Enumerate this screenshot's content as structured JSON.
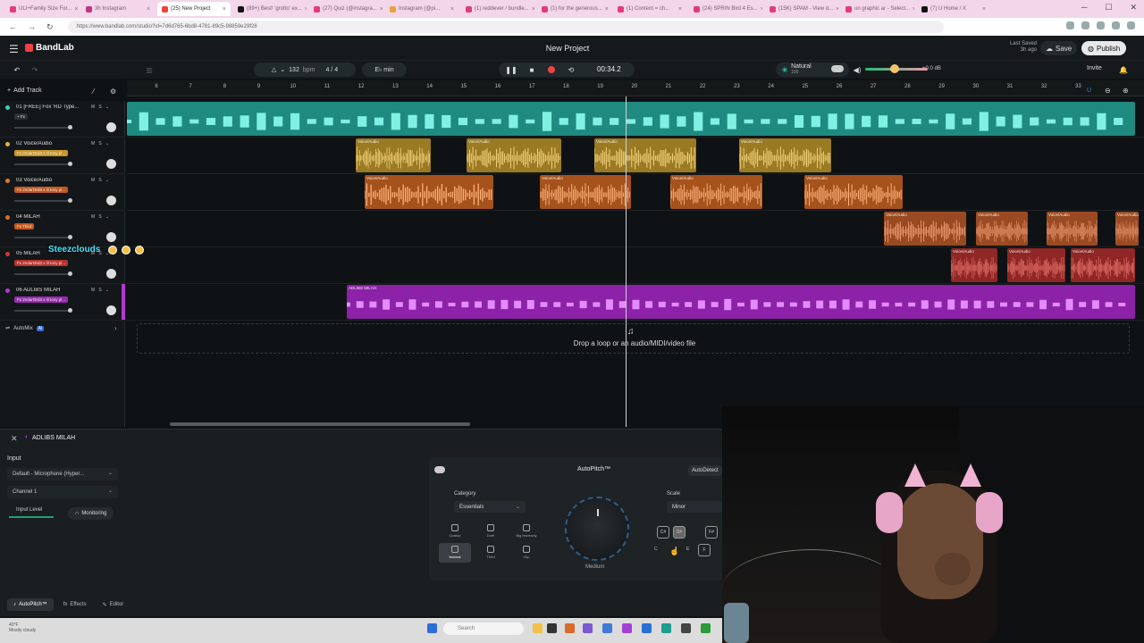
{
  "browser": {
    "tabs": [
      {
        "label": "ULI+Family Size For...",
        "color": "#e23b7b",
        "active": false
      },
      {
        "label": "3h Instagram",
        "color": "#c13584",
        "active": false
      },
      {
        "label": "(25) New Project",
        "color": "#f04040",
        "active": true
      },
      {
        "label": "(89+) Best! 'grotto' ex...",
        "color": "#111111",
        "active": false
      },
      {
        "label": "(27) Quiz (@instagra...",
        "color": "#e23b7b",
        "active": false
      },
      {
        "label": "Instagram (@pi...",
        "color": "#e8a13a",
        "active": false
      },
      {
        "label": "(1) reddever / bundle...",
        "color": "#e23b7b",
        "active": false
      },
      {
        "label": "(1) for the generous...",
        "color": "#e23b7b",
        "active": false
      },
      {
        "label": "(1) Content = ch...",
        "color": "#e23b7b",
        "active": false
      },
      {
        "label": "(24) SPRIN Bird 4 Es...",
        "color": "#e23b7b",
        "active": false
      },
      {
        "label": "(15K) SPAM - View d...",
        "color": "#e23b7b",
        "active": false
      },
      {
        "label": "un graphic ar - Select...",
        "color": "#e23b7b",
        "active": false
      },
      {
        "label": "(7) U Home / X",
        "color": "#111111",
        "active": false
      }
    ],
    "url": "https://www.bandlab.com/studio?id=7d6d765-6bd8-4781-89c5-98859e29f28"
  },
  "header": {
    "app_name": "BandLab",
    "project_title": "New Project",
    "last_saved_label": "Last Saved",
    "last_saved_time": "3h ago",
    "save_label": "Save",
    "publish_label": "Publish"
  },
  "transport": {
    "bpm_value": "132",
    "bpm_unit": "bpm",
    "time_signature": "4 / 4",
    "key": "E♭ min",
    "time": "00:34.2",
    "preset_label": "Natural",
    "preset_sub": "100",
    "db": "+0.0 dB",
    "invite_label": "Invite",
    "add_track_label": "Add Track"
  },
  "ruler": {
    "marks": [
      "6",
      "7",
      "8",
      "9",
      "10",
      "11",
      "12",
      "13",
      "14",
      "15",
      "16",
      "17",
      "18",
      "19",
      "20",
      "21",
      "22",
      "23",
      "24",
      "25",
      "26",
      "27",
      "28",
      "29",
      "30",
      "31",
      "32",
      "33"
    ]
  },
  "tracks": [
    {
      "name": "01 [FREE] Fox 'RD Type...",
      "fx": "+ Fx",
      "fx_color": "#2b3034",
      "color": "#3ad0c0"
    },
    {
      "name": "02 Voice/Audio",
      "fx": "Fx 2ndart3rd3 x lil tony pl...",
      "fx_color": "#c9962a",
      "color": "#e3b340"
    },
    {
      "name": "03 Voice/Audio",
      "fx": "Fx 2ndart3rd3 x lil tony pl...",
      "fx_color": "#c1581f",
      "color": "#e07b2a"
    },
    {
      "name": "04 MILAH",
      "fx": "Fx Third",
      "fx_color": "#c1581f",
      "color": "#d86c2c"
    },
    {
      "name": "05 MILAH",
      "fx": "Fx 2ndart3rd3 x lil tony pl...",
      "fx_color": "#b8332e",
      "color": "#c93a36"
    },
    {
      "name": "06 ADLIBS MILAH",
      "fx": "Fx 2ndart3rd3 x lil tony pl...",
      "fx_color": "#9a2bb0",
      "color": "#b637d4"
    }
  ],
  "clips": {
    "voice_audio_label": "Voice/Audio",
    "adlibs_label": "ADLIBS MILAH"
  },
  "automix_label": "AutoMix",
  "automix_badge": "AI",
  "drop_text": "Drop a loop or an audio/MIDI/video file",
  "streamer": {
    "name": "Steezclouds"
  },
  "panel": {
    "title": "ADLIBS MILAH",
    "input_label": "Input",
    "device": "Default - Microphone (Hyper...",
    "channel": "Channel 1",
    "input_level_label": "Input Level",
    "monitoring_label": "Monitoring"
  },
  "autopitch": {
    "title": "AutoPitch™",
    "autodetect_label": "AutoDetect",
    "category_label": "Category",
    "category_value": "Essentials",
    "presets_row1": [
      "Classic",
      "Duet",
      "Big Harmony"
    ],
    "presets_row2": [
      "Natural",
      "Third",
      "Clip"
    ],
    "amount_label": "Medium",
    "scale_label": "Scale",
    "scale_value": "Minor",
    "key_buttons": [
      "C#",
      "D#",
      "F#"
    ],
    "key_labels": [
      "C",
      "E",
      "F"
    ]
  },
  "bottom_tabs": {
    "autopitch": "AutoPitch™",
    "effects": "Effects",
    "editor": "Editor"
  },
  "taskbar": {
    "weather_temp": "40°F",
    "weather_desc": "Mostly cloudy",
    "search_placeholder": "Search"
  },
  "colors": {
    "track1": "#3ad0c0",
    "track2": "#e3b340",
    "track3": "#e07b2a",
    "track4": "#d86c2c",
    "track5": "#c93a36",
    "track6": "#b637d4",
    "accent": "#f04040"
  }
}
